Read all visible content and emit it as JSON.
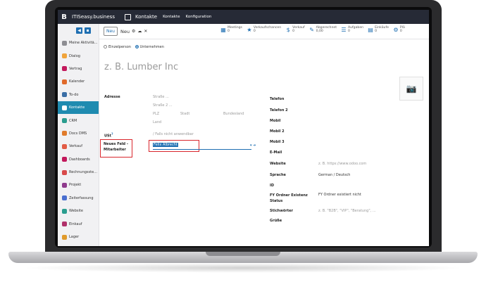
{
  "topbar": {
    "logo": "B",
    "brand": "ITISeasy.business",
    "app": "Kontakte",
    "menu": [
      "Kontakte",
      "Konfiguration"
    ]
  },
  "sidebar": {
    "items": [
      {
        "label": "Meine Aktivitä...",
        "color": "#8d8d92"
      },
      {
        "label": "Dialog",
        "color": "#f0a33a"
      },
      {
        "label": "Vertrag",
        "color": "#c2185b"
      },
      {
        "label": "Kalender",
        "color": "#e06a2b"
      },
      {
        "label": "To-do",
        "color": "#3a6ea5"
      },
      {
        "label": "Kontakte",
        "color": "#ffffff",
        "active": true
      },
      {
        "label": "CRM",
        "color": "#2a9d8f"
      },
      {
        "label": "Docs DMS",
        "color": "#e07b2b"
      },
      {
        "label": "Verkauf",
        "color": "#e25b45"
      },
      {
        "label": "Dashboards",
        "color": "#c2185b"
      },
      {
        "label": "Rechnungsste...",
        "color": "#d84a4a"
      },
      {
        "label": "Projekt",
        "color": "#8e3a8c"
      },
      {
        "label": "Zeiterfassung",
        "color": "#4a6fd0"
      },
      {
        "label": "Website",
        "color": "#2a9d8f"
      },
      {
        "label": "Einkauf",
        "color": "#b0306a"
      },
      {
        "label": "Lager",
        "color": "#e09a2b"
      }
    ]
  },
  "control": {
    "new_button": "Neu",
    "title": "Neu",
    "stats": [
      {
        "label": "Meetings",
        "value": "0"
      },
      {
        "label": "Verkaufschancen",
        "value": "0"
      },
      {
        "label": "Verkauf",
        "value": "0"
      },
      {
        "label": "Abgerechnet",
        "value": "0,00"
      },
      {
        "label": "Aufgaben",
        "value": "0"
      },
      {
        "label": "Einkäufe",
        "value": "0"
      },
      {
        "label": "Plä",
        "value": "0"
      }
    ]
  },
  "form": {
    "type_person": "Einzelperson",
    "type_company": "Unternehmen",
    "name_placeholder": "z. B. Lumber Inc",
    "address_label": "Adresse",
    "street": "Straße ...",
    "street2": "Straße 2 ...",
    "zip": "PLZ",
    "city": "Stadt",
    "state": "Bundesland",
    "country": "Land",
    "vat_label": "USt",
    "vat_placeholder": "/ Falls nicht anwendbar",
    "custom_label": "Neues Feld - Mitarbeiter",
    "custom_value": "Felix Albrecht",
    "right_labels": [
      "Telefon",
      "Telefon 2",
      "Mobil",
      "Mobil 2",
      "Mobil 3",
      "E-Mail",
      "Website",
      "Sprache",
      "ID",
      "FY Ordner Existenz Status",
      "Stichwörter",
      "Grüße"
    ],
    "website_placeholder": "z. B. https://www.odoo.com",
    "language": "German / Deutsch",
    "fy_status": "FY Ordner existiert nicht",
    "tags_placeholder": "z. B. \"B2B\", \"VIP\", \"Beratung\", ..."
  }
}
